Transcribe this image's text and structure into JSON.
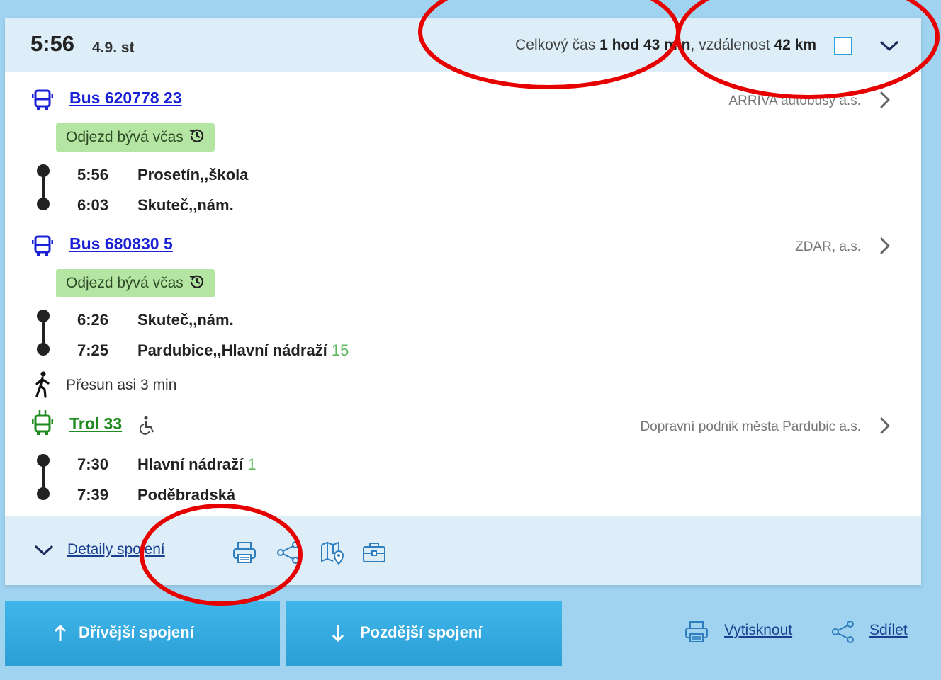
{
  "header": {
    "time": "5:56",
    "date": "4.9. st",
    "total_label": "Celkový čas",
    "total_value": "1 hod 43 min",
    "distance_label": "vzdálenost",
    "distance_value": "42 km"
  },
  "legs": [
    {
      "type": "bus",
      "line": "Bus 620778 23",
      "operator": "ARRIVA autobusy a.s.",
      "badge": "Odjezd bývá včas",
      "stops": [
        {
          "time": "5:56",
          "name": "Prosetín,,škola",
          "platform": ""
        },
        {
          "time": "6:03",
          "name": "Skuteč,,nám.",
          "platform": ""
        }
      ]
    },
    {
      "type": "bus",
      "line": "Bus 680830 5",
      "operator": "ZDAR, a.s.",
      "badge": "Odjezd bývá včas",
      "stops": [
        {
          "time": "6:26",
          "name": "Skuteč,,nám.",
          "platform": ""
        },
        {
          "time": "7:25",
          "name": "Pardubice,,Hlavní nádraží",
          "platform": "15"
        }
      ]
    },
    {
      "type": "trolleybus",
      "line": "Trol 33",
      "operator": "Dopravní podnik města Pardubic a.s.",
      "stops": [
        {
          "time": "7:30",
          "name": "Hlavní nádraží",
          "platform": "1"
        },
        {
          "time": "7:39",
          "name": "Poděbradská",
          "platform": ""
        }
      ]
    }
  ],
  "transfer": "Přesun asi 3 min",
  "footer": {
    "details_label": "Detaily spojení"
  },
  "buttons": {
    "earlier": "Dřívější spojení",
    "later": "Pozdější spojení"
  },
  "bottom_links": {
    "print": "Vytisknout",
    "share": "Sdílet"
  },
  "colors": {
    "page_background": "#9fd3ef",
    "header_background": "#ddeef8",
    "bus_blue": "#1a21d4",
    "trolley_green": "#1f8a1f",
    "badge_green": "#b4e5a2",
    "platform_green": "#5cb85c",
    "button_blue": "#3fb6ea",
    "annotation_red": "#e60000"
  },
  "icons": [
    "bus-icon",
    "trolleybus-icon",
    "wheelchair-icon",
    "walking-person-icon",
    "history-clock-icon",
    "chevron-down-icon",
    "chevron-right-icon",
    "printer-icon",
    "share-icon",
    "map-icon",
    "briefcase-icon",
    "arrow-up-icon",
    "arrow-down-icon"
  ]
}
